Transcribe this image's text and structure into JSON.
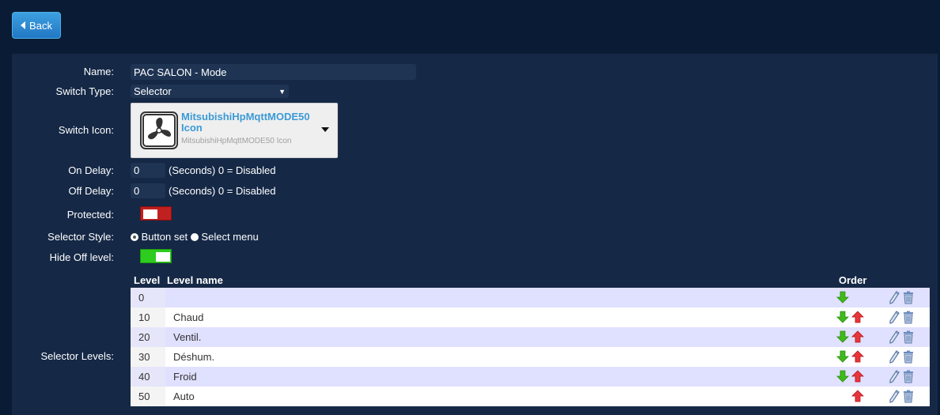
{
  "header": {
    "back_label": "Back"
  },
  "form": {
    "name_label": "Name:",
    "name_value": "PAC SALON - Mode",
    "switch_type_label": "Switch Type:",
    "switch_type_value": "Selector",
    "switch_icon_label": "Switch Icon:",
    "icon_title": "MitsubishiHpMqttMODE50 Icon",
    "icon_subtitle": "MitsubishiHpMqttMODE50 Icon",
    "on_delay_label": "On Delay:",
    "on_delay_value": "0",
    "on_delay_hint": "(Seconds) 0 = Disabled",
    "off_delay_label": "Off Delay:",
    "off_delay_value": "0",
    "off_delay_hint": "(Seconds) 0 = Disabled",
    "protected_label": "Protected:",
    "protected_on": false,
    "selector_style_label": "Selector Style:",
    "style_option_1": "Button set",
    "style_option_2": "Select menu",
    "style_selected": "Button set",
    "hide_off_label": "Hide Off level:",
    "hide_off_on": true,
    "selector_levels_label": "Selector Levels:"
  },
  "levels_table": {
    "col_level": "Level",
    "col_name": "Level name",
    "col_order": "Order",
    "rows": [
      {
        "level": "0",
        "name": "",
        "down": true,
        "up": false
      },
      {
        "level": "10",
        "name": "Chaud",
        "down": true,
        "up": true
      },
      {
        "level": "20",
        "name": "Ventil.",
        "down": true,
        "up": true
      },
      {
        "level": "30",
        "name": "Déshum.",
        "down": true,
        "up": true
      },
      {
        "level": "40",
        "name": "Froid",
        "down": true,
        "up": true
      },
      {
        "level": "50",
        "name": "Auto",
        "down": false,
        "up": true
      }
    ]
  },
  "colors": {
    "background": "#0a1c35",
    "panel": "#152846",
    "accent": "#2a88d0",
    "toggle_off": "#c0201f",
    "toggle_on": "#2ecc1f",
    "arrow_down": "#3fba1b",
    "arrow_up": "#e8353a"
  },
  "icons": [
    "caret-left-icon",
    "fan-icon",
    "chevron-down-icon",
    "arrow-down-icon",
    "arrow-up-icon",
    "pencil-icon",
    "trash-icon"
  ]
}
